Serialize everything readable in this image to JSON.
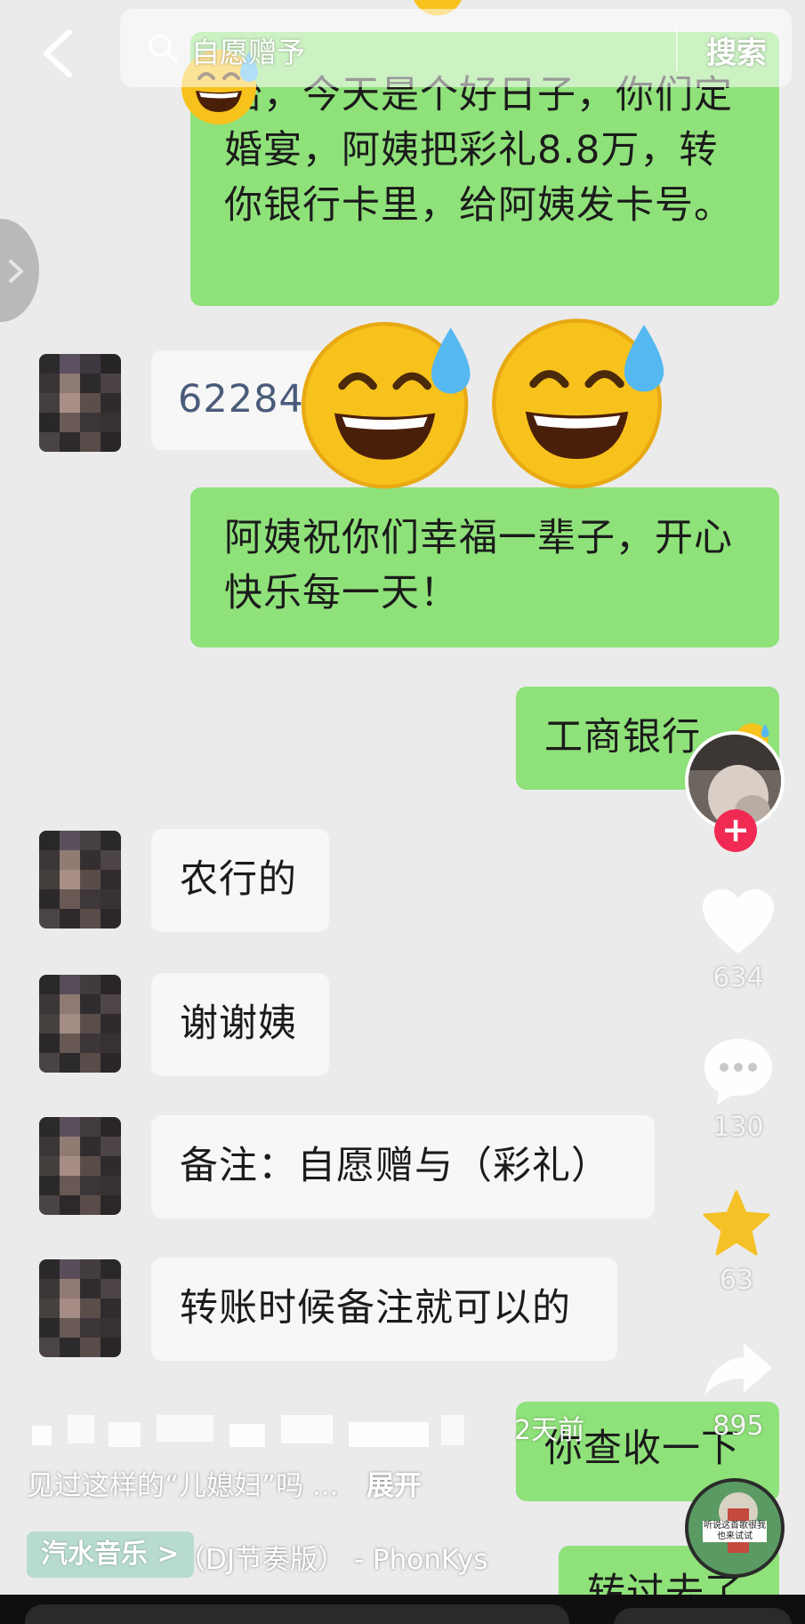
{
  "search": {
    "query": "自愿赠予",
    "button_label": "搜索"
  },
  "chat": {
    "msg_bride_price": "怡，今天是个好日子，你们定婚宴，阿姨把彩礼8.8万，转你银行卡里，给阿姨发卡号。",
    "msg_card_number": "62284",
    "msg_blessing": "阿姨祝你们幸福一辈子，开心快乐每一天！",
    "msg_bank": "工商银行",
    "msg_abc": "农行的",
    "msg_thanks": "谢谢姨",
    "msg_note": "备注：自愿赠与（彩礼）",
    "msg_remark": "转账时候备注就可以的",
    "msg_check": "你查收一下",
    "msg_transferred": "转过去了"
  },
  "rail": {
    "like_count": "634",
    "comment_count": "130",
    "favorite_count": "63",
    "share_count": "895"
  },
  "post": {
    "time": "2天前",
    "caption": "见过这样的“儿媳妇”吗 ...",
    "expand_label": "展开",
    "music_app": "汽水音乐 >",
    "music_track": "（DJ节奏版） - PhonKys",
    "disc_text": "听说这首歌很我也来试试"
  },
  "icons": {
    "back": "chevron-left-icon",
    "search": "search-icon",
    "side": "chevron-right-icon",
    "like": "heart-icon",
    "comment": "comment-icon",
    "favorite": "star-icon",
    "share": "share-icon",
    "emoji": "grinning-sweat-emoji"
  },
  "colors": {
    "my_bubble": "#8fe17a",
    "their_bubble": "#f7f7f7",
    "follow_badge": "#f12a53",
    "star": "#f6c126"
  }
}
